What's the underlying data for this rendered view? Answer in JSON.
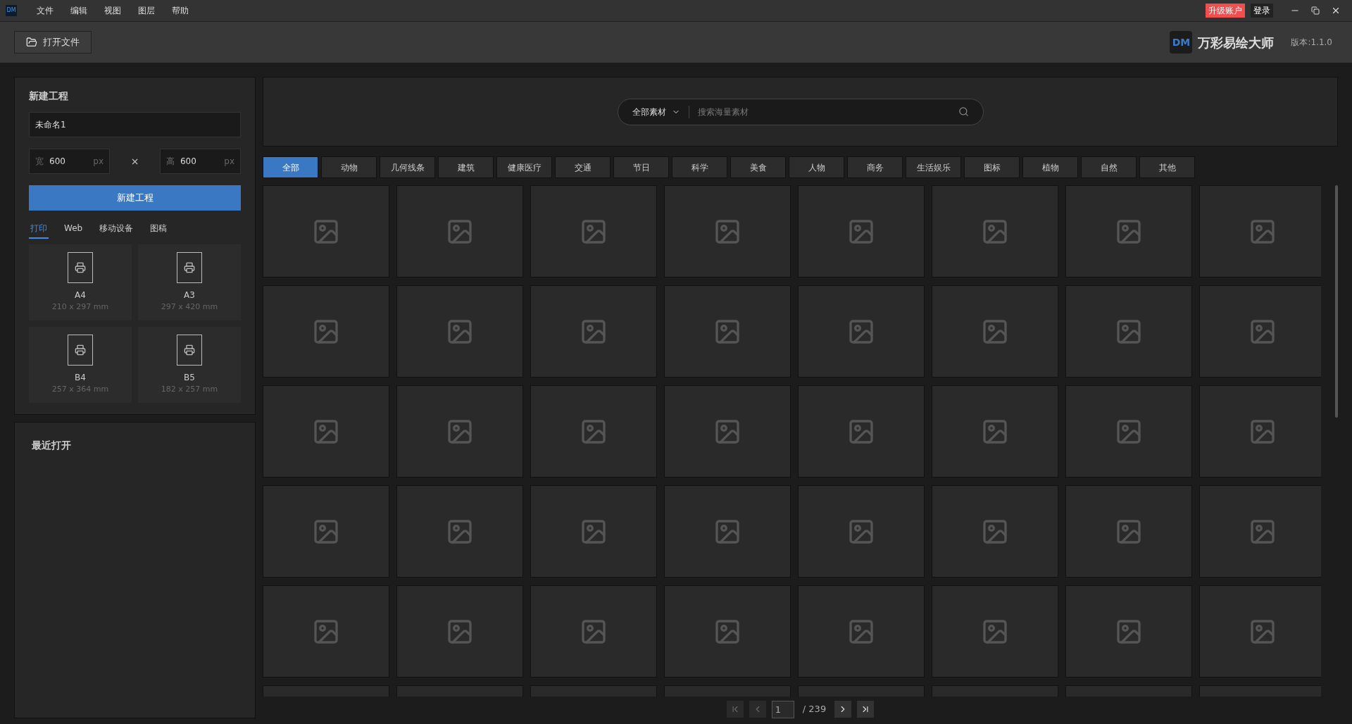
{
  "app_logo": "DM",
  "menu": [
    "文件",
    "编辑",
    "视图",
    "图层",
    "帮助"
  ],
  "title_bar": {
    "upgrade": "升级账户",
    "login": "登录"
  },
  "toolbar": {
    "open_file": "打开文件",
    "brand_logo": "DM",
    "brand_name": "万彩易绘大师",
    "version": "版本:1.1.0"
  },
  "new_project": {
    "title": "新建工程",
    "name_value": "未命名1",
    "width_label": "宽",
    "width_value": "600",
    "width_unit": "px",
    "times": "×",
    "height_label": "高",
    "height_value": "600",
    "height_unit": "px",
    "create_button": "新建工程",
    "tabs": [
      {
        "label": "打印",
        "selected": true
      },
      {
        "label": "Web",
        "selected": false
      },
      {
        "label": "移动设备",
        "selected": false
      },
      {
        "label": "图稿",
        "selected": false
      }
    ],
    "presets": [
      {
        "name": "A4",
        "size": "210 x 297 mm"
      },
      {
        "name": "A3",
        "size": "297 x 420 mm"
      },
      {
        "name": "B4",
        "size": "257 x 364 mm"
      },
      {
        "name": "B5",
        "size": "182 x 257 mm"
      }
    ]
  },
  "recent": {
    "title": "最近打开"
  },
  "search": {
    "scope": "全部素材",
    "placeholder": "搜索海量素材"
  },
  "categories": [
    {
      "label": "全部",
      "selected": true
    },
    {
      "label": "动物",
      "selected": false
    },
    {
      "label": "几何线条",
      "selected": false
    },
    {
      "label": "建筑",
      "selected": false
    },
    {
      "label": "健康医疗",
      "selected": false
    },
    {
      "label": "交通",
      "selected": false
    },
    {
      "label": "节日",
      "selected": false
    },
    {
      "label": "科学",
      "selected": false
    },
    {
      "label": "美食",
      "selected": false
    },
    {
      "label": "人物",
      "selected": false
    },
    {
      "label": "商务",
      "selected": false
    },
    {
      "label": "生活娱乐",
      "selected": false
    },
    {
      "label": "图标",
      "selected": false
    },
    {
      "label": "植物",
      "selected": false
    },
    {
      "label": "自然",
      "selected": false
    },
    {
      "label": "其他",
      "selected": false
    }
  ],
  "pagination": {
    "page": "1",
    "total": "/ 239"
  }
}
